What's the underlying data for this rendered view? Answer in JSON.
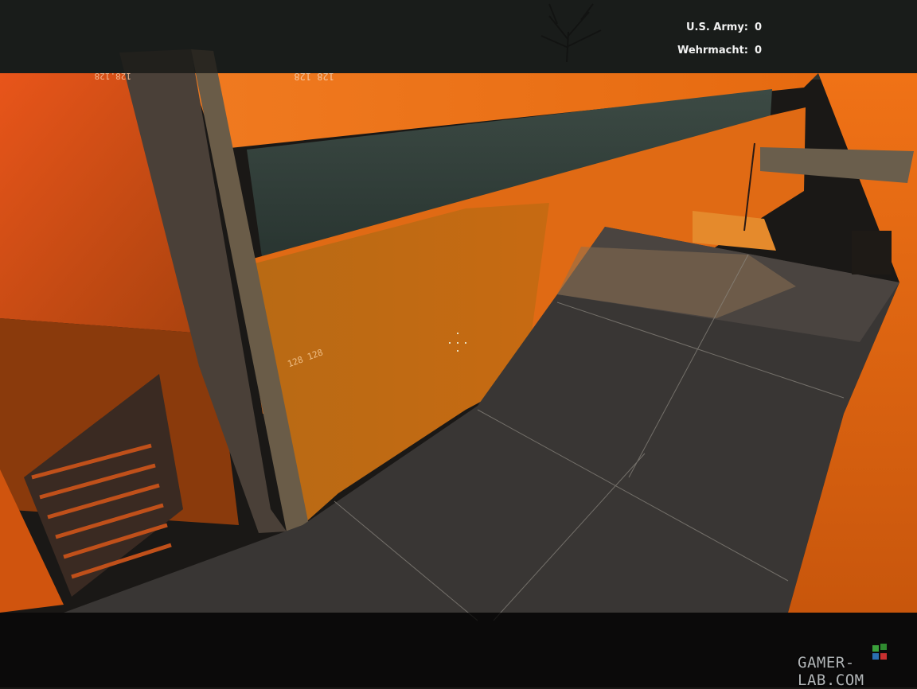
{
  "hud": {
    "scores": [
      {
        "team": "U.S. Army:",
        "score": "0"
      },
      {
        "team": "Wehrmacht:",
        "score": "0"
      }
    ]
  },
  "world_labels": {
    "tex_a": "128 128",
    "tex_b": "128.128",
    "tex_c": "128 128"
  },
  "watermark": {
    "text": "GAMER-LAB.COM"
  },
  "colors": {
    "orange_wall": "#e8661a",
    "orange_lit": "#f57e1c",
    "floor": "#3b3836",
    "hud_bar": "#121412"
  }
}
